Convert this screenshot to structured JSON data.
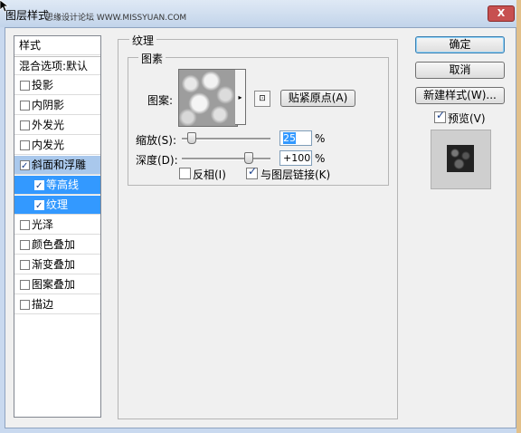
{
  "window": {
    "title": "图层样式",
    "watermark": "思缘设计论坛 WWW.MISSYUAN.COM",
    "close_label": "X"
  },
  "style_list": {
    "header": "样式",
    "blend_options": "混合选项:默认",
    "items": [
      {
        "label": "投影",
        "checked": false
      },
      {
        "label": "内阴影",
        "checked": false
      },
      {
        "label": "外发光",
        "checked": false
      },
      {
        "label": "内发光",
        "checked": false
      },
      {
        "label": "斜面和浮雕",
        "checked": true
      },
      {
        "label": "等高线",
        "checked": true
      },
      {
        "label": "纹理",
        "checked": true
      },
      {
        "label": "光泽",
        "checked": false
      },
      {
        "label": "颜色叠加",
        "checked": false
      },
      {
        "label": "渐变叠加",
        "checked": false
      },
      {
        "label": "图案叠加",
        "checked": false
      },
      {
        "label": "描边",
        "checked": false
      }
    ]
  },
  "texture_panel": {
    "group_title": "纹理",
    "subgroup_title": "图素",
    "pattern_label": "图案:",
    "snap_button": "贴紧原点(A)",
    "scale_label": "缩放(S):",
    "scale_value": "25",
    "scale_unit": "%",
    "depth_label": "深度(D):",
    "depth_value": "+100",
    "depth_unit": "%",
    "invert_label": "反相(I)",
    "invert_checked": false,
    "link_label": "与图层链接(K)",
    "link_checked": true
  },
  "buttons": {
    "ok": "确定",
    "cancel": "取消",
    "new_style": "新建样式(W)...",
    "preview_label": "预览(V)",
    "preview_checked": true
  }
}
